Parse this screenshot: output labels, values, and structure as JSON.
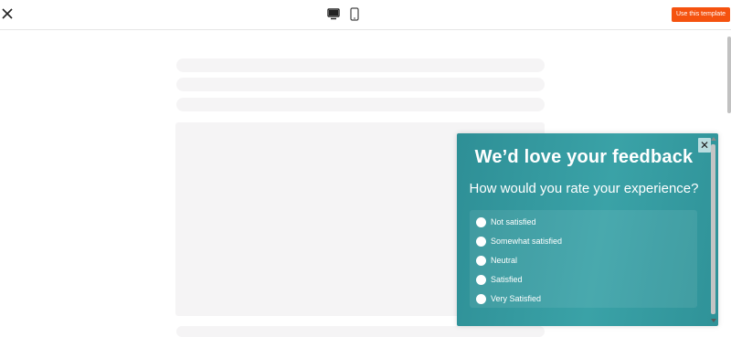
{
  "toolbar": {
    "close_icon": "close-icon",
    "desktop_icon": "desktop-icon",
    "mobile_icon": "mobile-icon",
    "use_template_label": "Use this template",
    "use_template_color": "#f5520f"
  },
  "widget": {
    "title": "We’d love your feedback",
    "question": "How would you rate your experience?",
    "close_label": "✕",
    "background_color": "#3aa2a7",
    "options": [
      {
        "label": "Not satisfied"
      },
      {
        "label": "Somewhat satisfied"
      },
      {
        "label": "Neutral"
      },
      {
        "label": "Satisfied"
      },
      {
        "label": "Very Satisfied"
      }
    ]
  }
}
